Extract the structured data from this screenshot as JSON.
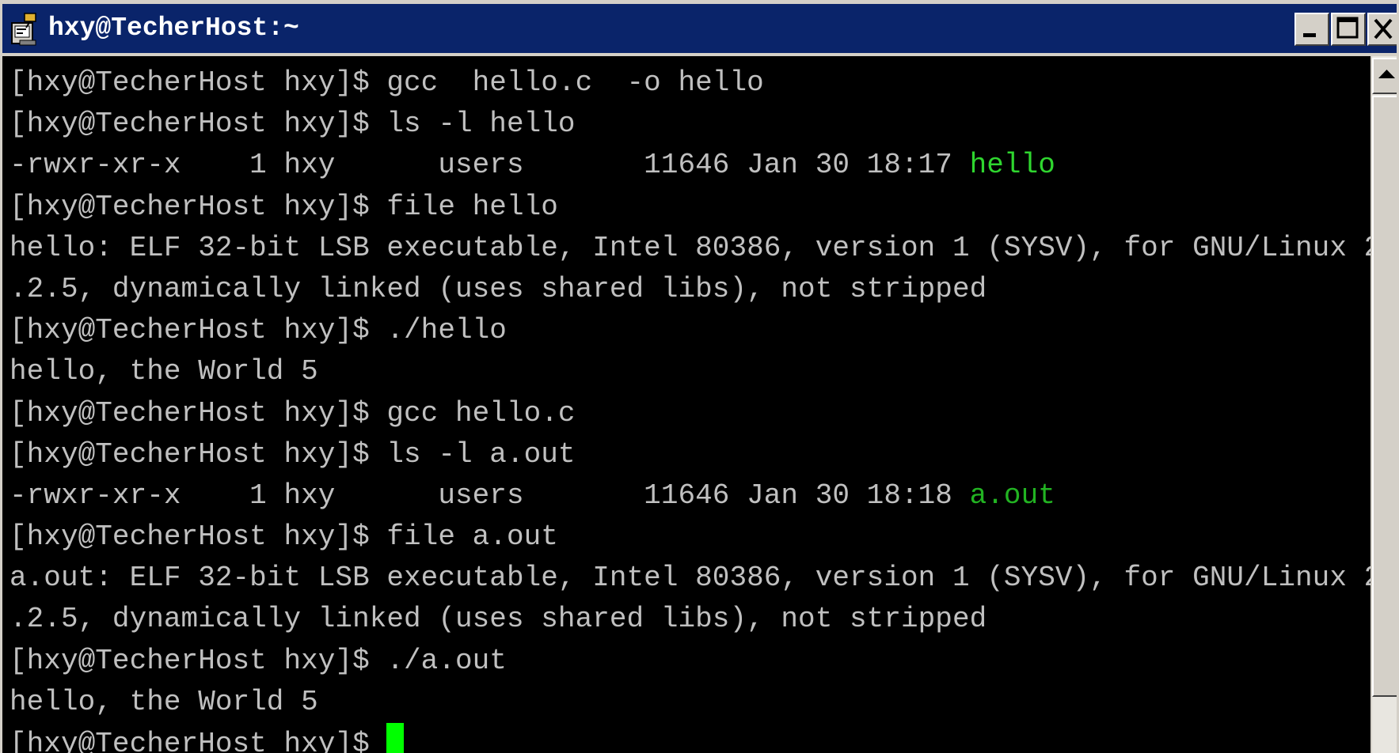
{
  "window": {
    "title": "hxy@TecherHost:~"
  },
  "titlebar_buttons": {
    "minimize_icon": "minimize-icon",
    "maximize_icon": "maximize-icon",
    "close_icon": "close-icon"
  },
  "terminal": {
    "lines": [
      "[hxy@TecherHost hxy]$ gcc  hello.c  -o hello",
      "[hxy@TecherHost hxy]$ ls -l hello",
      {
        "prefix": "-rwxr-xr-x    1 hxy      users       11646 Jan 30 18:17 ",
        "highlight": "hello"
      },
      "[hxy@TecherHost hxy]$ file hello",
      "hello: ELF 32-bit LSB executable, Intel 80386, version 1 (SYSV), for GNU/Linux 2",
      ".2.5, dynamically linked (uses shared libs), not stripped",
      "[hxy@TecherHost hxy]$ ./hello",
      "hello, the World 5",
      "[hxy@TecherHost hxy]$ gcc hello.c",
      "[hxy@TecherHost hxy]$ ls -l a.out",
      {
        "prefix": "-rwxr-xr-x    1 hxy      users       11646 Jan 30 18:18 ",
        "highlight": "a.out"
      },
      "[hxy@TecherHost hxy]$ file a.out",
      "a.out: ELF 32-bit LSB executable, Intel 80386, version 1 (SYSV), for GNU/Linux 2",
      ".2.5, dynamically linked (uses shared libs), not stripped",
      "[hxy@TecherHost hxy]$ ./a.out",
      "hello, the World 5",
      {
        "prompt": "[hxy@TecherHost hxy]$ ",
        "cursor": true
      }
    ]
  },
  "colors": {
    "titlebar": "#0a246a",
    "terminal_bg": "#000000",
    "terminal_fg": "#c0c0c0",
    "executable": "#2fd62f",
    "cursor": "#00ff00"
  }
}
